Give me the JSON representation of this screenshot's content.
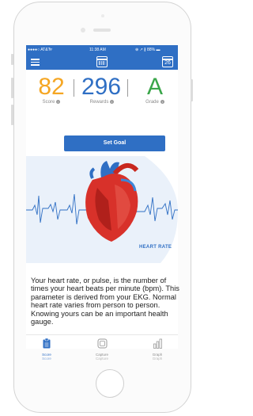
{
  "status_bar": {
    "carrier": "●●●●○ AT&T",
    "wifi": "ᯤ",
    "time": "11:38 AM",
    "battery": "⊕ ↗ ∦ 88% ▬"
  },
  "nav": {
    "menu_icon": "hamburger-icon",
    "calendar_icon": "calendar-icon",
    "date_badge": "26"
  },
  "stats": {
    "score": {
      "value": "82",
      "label": "Score",
      "color": "#f5a623"
    },
    "rewards": {
      "value": "296",
      "label": "Rewards",
      "color": "#2f6fc4"
    },
    "grade": {
      "value": "A",
      "label": "Grade",
      "color": "#3aa64a"
    }
  },
  "set_goal_label": "Set Goal",
  "hero": {
    "title": "HEART RATE"
  },
  "description": "Your heart rate, or pulse, is the number of times your heart beats per minute (bpm). This parameter is derived from your EKG. Normal heart rate varies from person to person. Knowing yours can be an important health gauge.",
  "tabs": [
    {
      "label1": "Score",
      "label2": "Score",
      "icon": "clipboard-icon",
      "active": true
    },
    {
      "label1": "Capture",
      "label2": "Capture",
      "icon": "capture-icon",
      "active": false
    },
    {
      "label1": "Graph",
      "label2": "Graph",
      "icon": "bar-graph-icon",
      "active": false
    }
  ],
  "colors": {
    "brand": "#2f6fc4",
    "accent_orange": "#f5a623",
    "accent_green": "#3aa64a"
  }
}
